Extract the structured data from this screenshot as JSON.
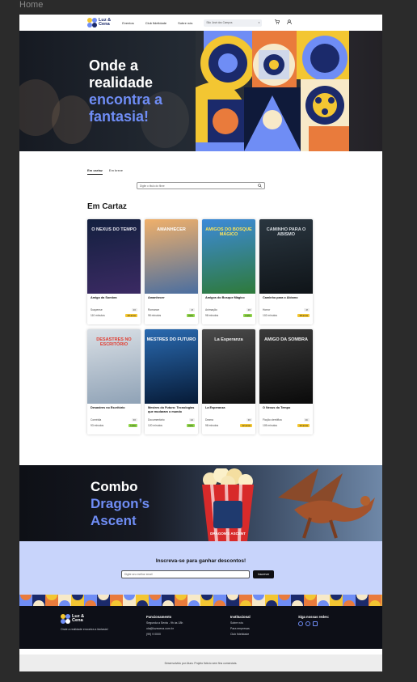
{
  "browser": {
    "tab_label": "Home"
  },
  "header": {
    "logo_line1": "Luz &",
    "logo_line2": "Cena",
    "nav": [
      "Eventos",
      "Club fidelidade",
      "Sobre nós"
    ],
    "location_select": "São José dos Campos",
    "location_arrow": "▾",
    "cart_icon": "cart-icon",
    "user_icon": "user-icon"
  },
  "hero": {
    "line1": "Onde a",
    "line2": "realidade",
    "line3": "encontra a",
    "line4": "fantasia!"
  },
  "tabs": {
    "now": "Em cartaz",
    "soon": "Em breve"
  },
  "film_search": {
    "placeholder": "Digite o título do filme",
    "icon": "search-icon"
  },
  "section_title": "Em Cartaz",
  "movies": [
    {
      "poster_text": "O NEXUS DO TEMPO",
      "title": "Amigo da Sombra",
      "genre": "Suspense",
      "duration": "110 minutos",
      "rating": "20",
      "badge": "13 anos",
      "colors": [
        "#13203f",
        "#3b2a63"
      ],
      "badge_color": "#f3c632",
      "poster_fg": "#e8e8f0"
    },
    {
      "poster_text": "AMANHECER",
      "title": "Amanhecer",
      "genre": "Romance",
      "duration": "98 minutos",
      "rating": "2f",
      "badge": "livre",
      "colors": [
        "#f0b06a",
        "#4a6ea0"
      ],
      "badge_color": "#8fd44a",
      "poster_fg": "#ffffff"
    },
    {
      "poster_text": "AMIGOS DO BOSQUE MÁGICO",
      "title": "Amigos do Bosque Mágico",
      "genre": "Animação",
      "duration": "98 minutos",
      "rating": "20",
      "badge": "Livre",
      "colors": [
        "#3d8ad8",
        "#2e7a3a"
      ],
      "badge_color": "#8fd44a",
      "poster_fg": "#ffe55a"
    },
    {
      "poster_text": "CAMINHO PARA O ABISMO",
      "title": "Caminho para o Abismo",
      "genre": "Horror",
      "duration": "102 minutos",
      "rating": "2f",
      "badge": "18 anos",
      "colors": [
        "#2a3640",
        "#0f1418"
      ],
      "badge_color": "#f3c632",
      "poster_fg": "#d8dde2"
    },
    {
      "poster_text": "DESASTRES NO ESCRITÓRIO",
      "title": "Desastres no Escritório",
      "genre": "Comédia",
      "duration": "93 minutos",
      "rating": "30",
      "badge": "Livre",
      "colors": [
        "#d9dfe5",
        "#8fa2b6"
      ],
      "badge_color": "#8fd44a",
      "poster_fg": "#e23b2e"
    },
    {
      "poster_text": "MESTRES DO FUTURO",
      "title": "Mestres do Futuro: Tecnologias que mudaram o mundo",
      "genre": "Documentário",
      "duration": "120 minutos",
      "rating": "2d",
      "badge": "livre",
      "colors": [
        "#2a6ab0",
        "#061a36"
      ],
      "badge_color": "#8fd44a",
      "poster_fg": "#ffffff"
    },
    {
      "poster_text": "La Esperanza",
      "title": "La Esperanza",
      "genre": "Drama",
      "duration": "98 minutos",
      "rating": "30",
      "badge": "12 anos",
      "colors": [
        "#4a4a4a",
        "#111111"
      ],
      "badge_color": "#f3c632",
      "poster_fg": "#f0f0f0"
    },
    {
      "poster_text": "AMIGO DA SOMBRA",
      "title": "O Nexus do Tempo",
      "genre": "Ficção científica",
      "duration": "105 minutos",
      "rating": "1b",
      "badge": "12 anos",
      "colors": [
        "#3a3a3a",
        "#0a0a0a"
      ],
      "badge_color": "#f3c632",
      "poster_fg": "#f0f0f0"
    }
  ],
  "combo": {
    "line1": "Combo",
    "line2": "Dragon’s",
    "line3": "Ascent",
    "bucket_text": "DRAGON'S ASCENT"
  },
  "newsletter": {
    "title": "Inscreva-se para ganhar descontos!",
    "placeholder": "Digite seu melhor email",
    "button": "Inscrever"
  },
  "footer": {
    "logo_line1": "Luz &",
    "logo_line2": "Cena",
    "tagline": "Onde a realidade encontra a fantasia!",
    "hours_title": "Funcionamento",
    "hours": [
      "Segunda a Sexta - 9h às 18h",
      "ola@luzecena.com.br",
      "(99) 9 0000"
    ],
    "inst_title": "Institucional",
    "inst_links": [
      "Sobre nós",
      "Para empresas",
      "Club fidelidade"
    ],
    "social_title": "Siga nossas redes:"
  },
  "copyright": "Desenvolvido por Alura. Projeto fictício sem fins comerciais.",
  "colors": {
    "brand_blue": "#6f8df5",
    "navy": "#1b2a6b",
    "yellow": "#f3c632"
  }
}
